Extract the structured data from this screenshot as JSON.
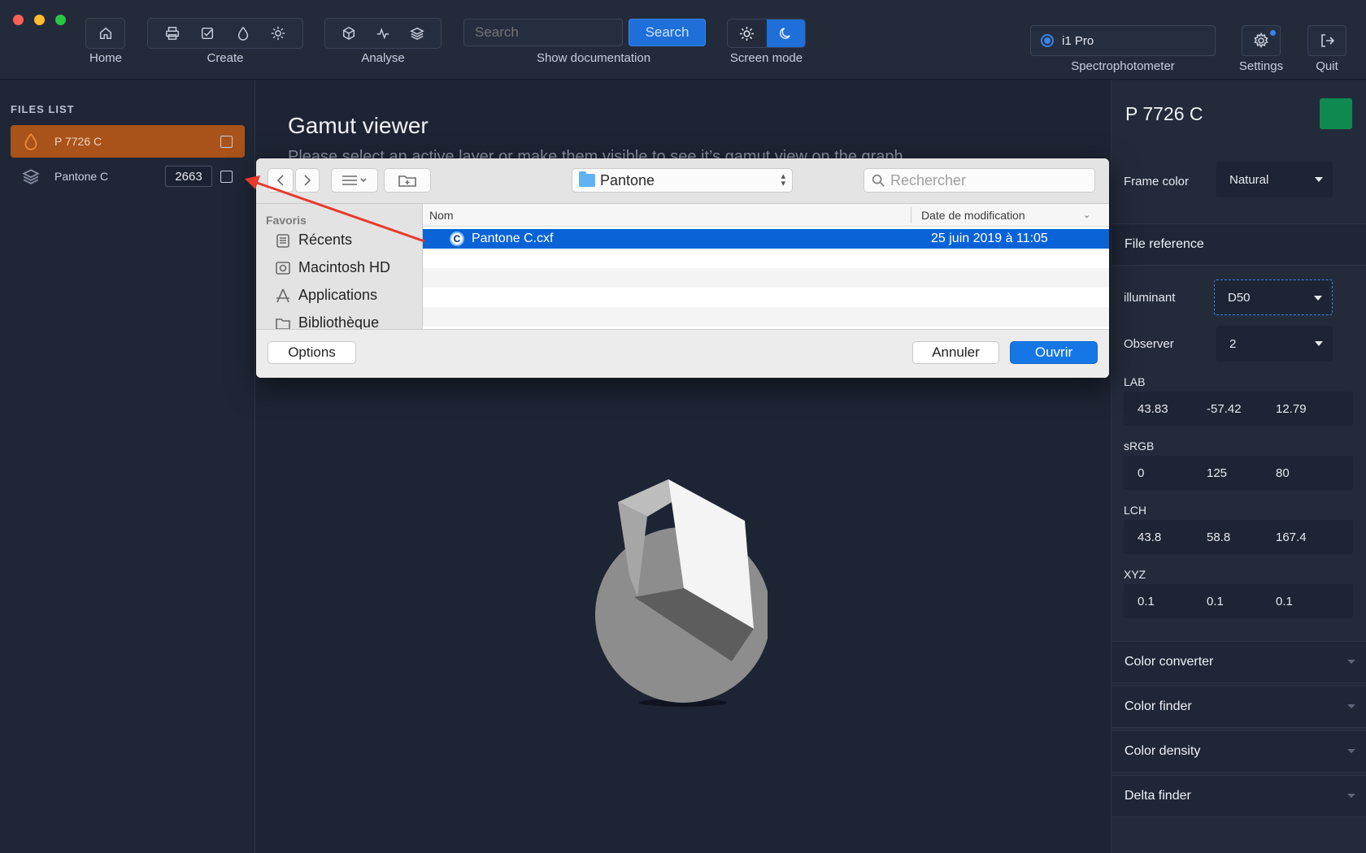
{
  "toolbar": {
    "home_label": "Home",
    "create_label": "Create",
    "analyse_label": "Analyse",
    "search_placeholder": "Search",
    "search_button": "Search",
    "show_doc_label": "Show documentation",
    "screen_mode_label": "Screen mode",
    "device_name": "i1 Pro",
    "spectro_label": "Spectrophotometer",
    "settings_label": "Settings",
    "quit_label": "Quit"
  },
  "sidebar": {
    "title": "FILES LIST",
    "files": [
      {
        "name": "P 7726 C",
        "icon": "drop-icon",
        "active": true
      },
      {
        "name": "Pantone C",
        "icon": "layers-icon",
        "count": "2663"
      }
    ]
  },
  "main": {
    "title": "Gamut viewer",
    "subtitle": "Please select an active layer or make them visible to see it’s gamut view on the graph."
  },
  "dialog": {
    "location": "Pantone",
    "search_placeholder": "Rechercher",
    "favorites_title": "Favoris",
    "favorites": [
      "Récents",
      "Macintosh HD",
      "Applications",
      "Bibliothèque"
    ],
    "col_name": "Nom",
    "col_date": "Date de modification",
    "file_icon_letter": "C",
    "files": [
      {
        "name": "Pantone C.cxf",
        "date": "25 juin 2019 à 11:05"
      }
    ],
    "options_button": "Options",
    "cancel_button": "Annuler",
    "open_button": "Ouvrir"
  },
  "panel": {
    "title": "P 7726 C",
    "swatch_color": "#0e8a50",
    "frame_color_label": "Frame color",
    "frame_color_value": "Natural",
    "file_reference": "File reference",
    "illuminant_label": "illuminant",
    "illuminant_value": "D50",
    "observer_label": "Observer",
    "observer_value": "2",
    "lab": {
      "label": "LAB",
      "values": [
        "43.83",
        "-57.42",
        "12.79"
      ]
    },
    "srgb": {
      "label": "sRGB",
      "values": [
        "0",
        "125",
        "80"
      ]
    },
    "lch": {
      "label": "LCH",
      "values": [
        "43.8",
        "58.8",
        "167.4"
      ]
    },
    "xyz": {
      "label": "XYZ",
      "values": [
        "0.1",
        "0.1",
        "0.1"
      ]
    },
    "sections": [
      "Color converter",
      "Color finder",
      "Color density",
      "Delta finder"
    ]
  },
  "colors": {
    "accent": "#1e6fd9",
    "active_file": "#a9521a",
    "annotation_arrow": "#e8392b"
  }
}
